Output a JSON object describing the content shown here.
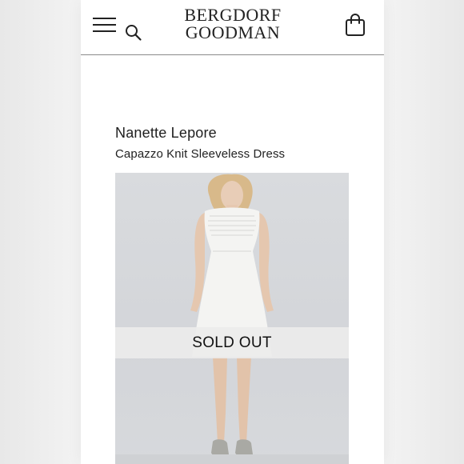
{
  "header": {
    "logo_line1": "BERGDORF",
    "logo_line2": "GOODMAN",
    "menu_icon": "hamburger-menu-icon",
    "search_icon": "search-icon",
    "bag_icon": "shopping-bag-icon"
  },
  "product": {
    "brand": "Nanette Lepore",
    "name": "Capazzo Knit Sleeveless Dress",
    "status_overlay": "SOLD OUT"
  },
  "colors": {
    "background": "#ececec",
    "text": "#1e1e1e",
    "overlay": "#ececec"
  }
}
